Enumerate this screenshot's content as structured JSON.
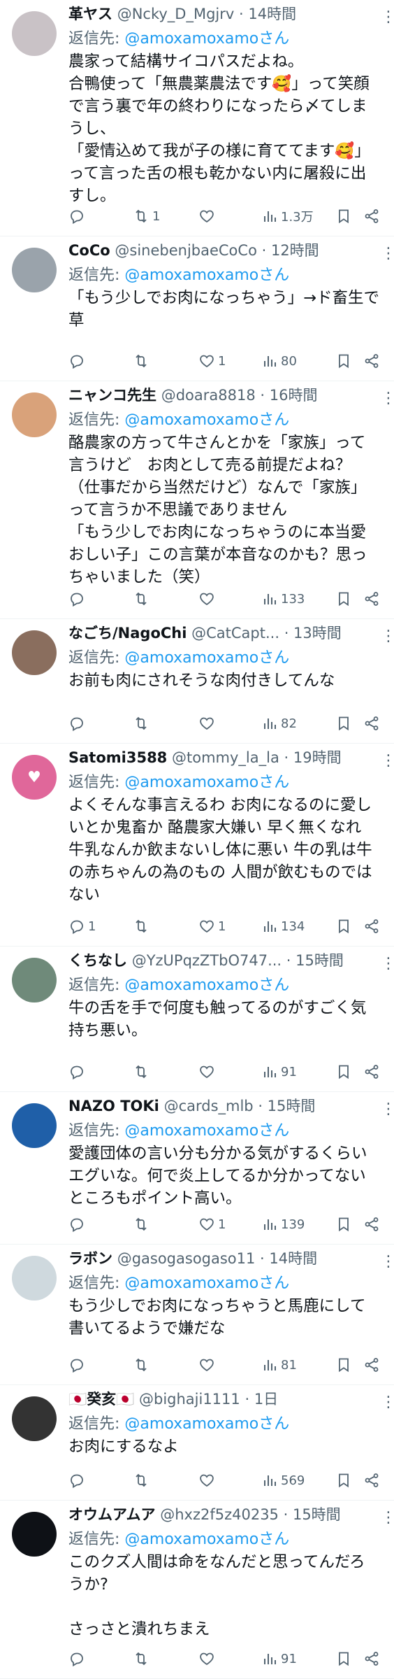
{
  "reply_prefix": "返信先: ",
  "tweets": [
    {
      "name": "革ヤス",
      "handle": "@Ncky_D_Mgjrv",
      "time": "14時間",
      "reply_to": "@amoxamoxamoさん",
      "text": "農家って結構サイコパスだよね。\n合鴨使って「無農薬農法です🥰」って笑顔で言う裏で年の終わりになったら〆てしまうし、\n「愛情込めて我が子の様に育ててます🥰」って言った舌の根も乾かない内に屠殺に出すし。",
      "replies": "",
      "retweets": "1",
      "likes": "",
      "views": "1.3万",
      "avatar_color": "#c9c2c6",
      "avatar_text": ""
    },
    {
      "name": "CoCo",
      "handle": "@sinebenjbaeCoCo",
      "time": "12時間",
      "reply_to": "@amoxamoxamoさん",
      "text": "「もう少しでお肉になっちゃう」→ド畜生で草",
      "replies": "",
      "retweets": "",
      "likes": "1",
      "views": "80",
      "avatar_color": "#9aa3ab",
      "avatar_text": ""
    },
    {
      "name": "ニャンコ先生",
      "handle": "@doara8818",
      "time": "16時間",
      "reply_to": "@amoxamoxamoさん",
      "text": "酪農家の方って牛さんとかを「家族」って言うけど　お肉として売る前提だよね？（仕事だから当然だけど）なんで「家族」って言うか不思議でありません\n「もう少しでお肉になっちゃうのに本当愛おしい子」この言葉が本音なのかも？思っちゃいました（笑）",
      "replies": "",
      "retweets": "",
      "likes": "",
      "views": "133",
      "avatar_color": "#d9a27a",
      "avatar_text": ""
    },
    {
      "name": "なごち/NagoChi",
      "handle": "@CatCapt...",
      "time": "13時間",
      "reply_to": "@amoxamoxamoさん",
      "text": "お前も肉にされそうな肉付きしてんな",
      "replies": "",
      "retweets": "",
      "likes": "",
      "views": "82",
      "avatar_color": "#8a6e5e",
      "avatar_text": ""
    },
    {
      "name": "Satomi3588",
      "handle": "@tommy_la_la",
      "time": "19時間",
      "reply_to": "@amoxamoxamoさん",
      "text": "よくそんな事言えるわ お肉になるのに愛しいとか鬼畜か 酪農家大嫌い 早く無くなれ 牛乳なんか飲まないし体に悪い 牛の乳は牛の赤ちゃんの為のもの 人間が飲むものではない",
      "replies": "1",
      "retweets": "",
      "likes": "1",
      "views": "134",
      "avatar_color": "#e0679a",
      "avatar_text": "♥"
    },
    {
      "name": "くちなし",
      "handle": "@YzUPqzZTbO747...",
      "time": "15時間",
      "reply_to": "@amoxamoxamoさん",
      "text": "牛の舌を手で何度も触ってるのがすごく気持ち悪い。",
      "replies": "",
      "retweets": "",
      "likes": "",
      "views": "91",
      "avatar_color": "#6f8a7a",
      "avatar_text": ""
    },
    {
      "name": "NAZO TOKi",
      "handle": "@cards_mlb",
      "time": "15時間",
      "reply_to": "@amoxamoxamoさん",
      "text": "愛護団体の言い分も分かる気がするくらいエグいな。何で炎上してるか分かってないところもポイント高い。",
      "replies": "",
      "retweets": "",
      "likes": "1",
      "views": "139",
      "avatar_color": "#1f5fa8",
      "avatar_text": ""
    },
    {
      "name": "ラボン",
      "handle": "@gasogasogaso11",
      "time": "14時間",
      "reply_to": "@amoxamoxamoさん",
      "text": "もう少しでお肉になっちゃうと馬鹿にして書いてるようで嫌だな",
      "replies": "",
      "retweets": "",
      "likes": "",
      "views": "81",
      "avatar_color": "#cfd9de",
      "avatar_text": ""
    },
    {
      "name": "🇯🇵癸亥🇯🇵",
      "handle": "@bighaji1111",
      "time": "1日",
      "reply_to": "@amoxamoxamoさん",
      "text": "お肉にするなよ",
      "replies": "",
      "retweets": "",
      "likes": "",
      "views": "569",
      "avatar_color": "#333333",
      "avatar_text": ""
    },
    {
      "name": "オウムアムア",
      "handle": "@hxz2f5z40235",
      "time": "15時間",
      "reply_to": "@amoxamoxamoさん",
      "text": "このクズ人間は命をなんだと思ってんだろうか?\n\nさっさと潰れちまえ",
      "replies": "",
      "retweets": "",
      "likes": "",
      "views": "91",
      "avatar_color": "#0e1116",
      "avatar_text": ""
    }
  ],
  "icons": [
    "reply-icon",
    "retweet-icon",
    "like-icon",
    "views-icon",
    "bookmark-icon",
    "share-icon",
    "more-icon"
  ]
}
